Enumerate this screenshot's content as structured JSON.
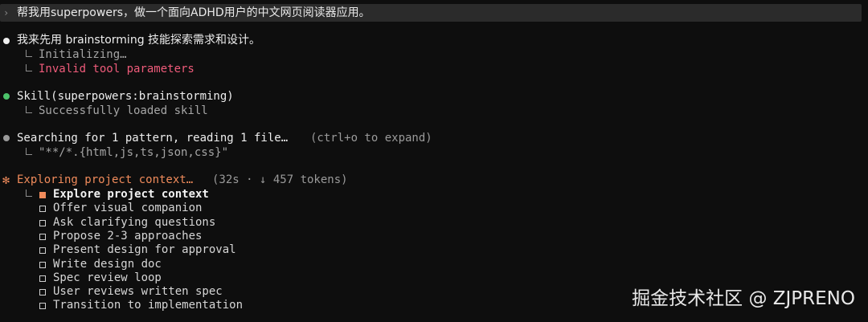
{
  "prompt": {
    "caret": "›",
    "text": "帮我用superpowers，做一个面向ADHD用户的中文网页阅读器应用。"
  },
  "messages": [
    {
      "title": "我来先用 brainstorming 技能探索需求和设计。",
      "sub": [
        "Initializing…",
        "Invalid tool parameters"
      ]
    },
    {
      "title": "Skill(superpowers:brainstorming)",
      "sub": [
        "Successfully loaded skill"
      ]
    },
    {
      "title": "Searching for 1 pattern, reading 1 file…",
      "hint": "(ctrl+o to expand)",
      "sub": [
        "\"**/*.{html,js,ts,json,css}\""
      ]
    }
  ],
  "status": {
    "star": "✻",
    "label": "Exploring project context…",
    "meta": "(32s · ↓ 457 tokens)"
  },
  "tasks": [
    {
      "label": "Explore project context",
      "active": true
    },
    {
      "label": "Offer visual companion",
      "active": false
    },
    {
      "label": "Ask clarifying questions",
      "active": false
    },
    {
      "label": "Propose 2-3 approaches",
      "active": false
    },
    {
      "label": "Present design for approval",
      "active": false
    },
    {
      "label": "Write design doc",
      "active": false
    },
    {
      "label": "Spec review loop",
      "active": false
    },
    {
      "label": "User reviews written spec",
      "active": false
    },
    {
      "label": "Transition to implementation",
      "active": false
    }
  ],
  "watermark": "掘金技术社区 @ ZJPRENO",
  "colors": {
    "background": "#0e0e0e",
    "prompt_bar": "#2b2b2b",
    "error": "#ee5b7a",
    "accent": "#f08b5b",
    "success_bullet": "#4cc36a"
  }
}
